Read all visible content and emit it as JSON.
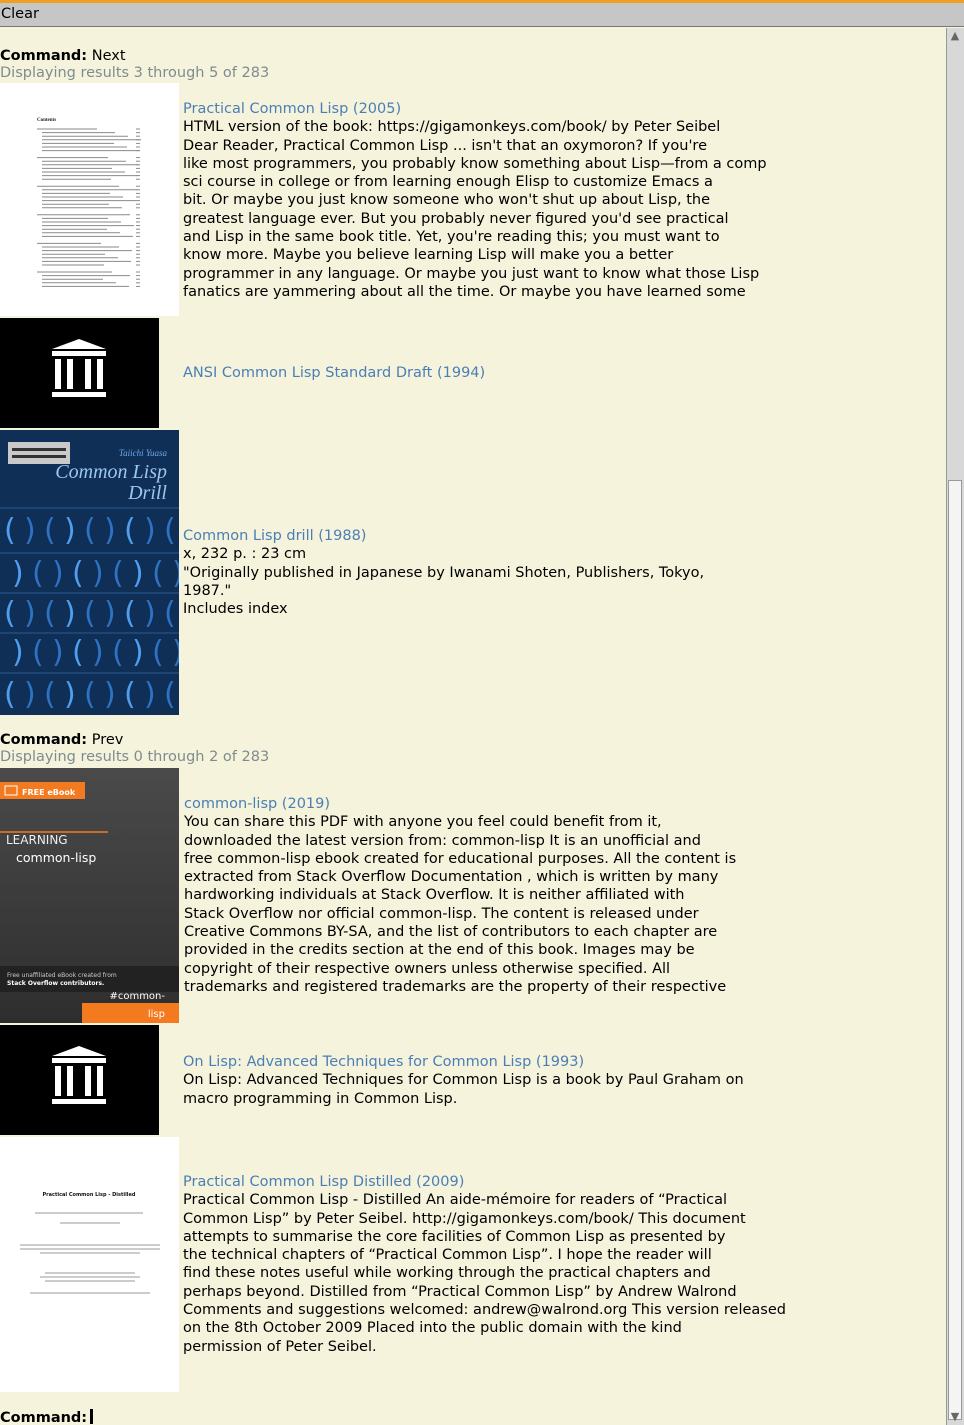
{
  "topbar": {
    "clear_label": "Clear"
  },
  "sections": [
    {
      "command_label": "Command:",
      "command_value": "Next",
      "status": "Displaying results 3 through 5 of 283"
    },
    {
      "command_label": "Command:",
      "command_value": "Prev",
      "status": "Displaying results 0 through 2 of 283"
    }
  ],
  "results": [
    {
      "title": "Practical Common Lisp (2005)",
      "desc": "HTML version of the book: https://gigamonkeys.com/book/ by Peter Seibel\nDear Reader, Practical Common Lisp ... isn't that an oxymoron? If you're\nlike most programmers, you probably know something about Lisp—from a comp\nsci course in college or from learning enough Elisp to customize Emacs a\nbit. Or maybe you just know someone who won't shut up about Lisp, the\ngreatest language ever. But you probably never figured you'd see practical\nand Lisp in the same book title. Yet, you're reading this; you must want to\nknow more. Maybe you believe learning Lisp will make you a better\nprogrammer in any language. Or maybe you just want to know what those Lisp\nfanatics are yammering about all the time. Or maybe you have learned some",
      "thumb_heading": "Contents"
    },
    {
      "title": "ANSI Common Lisp Standard Draft (1994)",
      "desc": ""
    },
    {
      "title": "Common Lisp drill (1988)",
      "desc": "x, 232 p. : 23 cm\n\"Originally published in Japanese by Iwanami Shoten, Publishers, Tokyo,\n1987.\"\nIncludes index",
      "thumb_author": "Taiichi Yuasa",
      "thumb_title1": "Common Lisp",
      "thumb_title2": "Drill"
    },
    {
      "title": "common-lisp (2019)",
      "desc": "You can share this PDF with anyone you feel could benefit from it,\ndownloaded the latest version from: common-lisp It is an unofficial and\nfree common-lisp ebook created for educational purposes. All the content is\nextracted from Stack Overflow Documentation , which is written by many\nhardworking individuals at Stack Overflow. It is neither affiliated with\nStack Overflow nor official common-lisp. The content is released under\nCreative Commons BY-SA, and the list of contributors to each chapter are\nprovided in the credits section at the end of this book. Images may be\ncopyright of their respective owners unless otherwise specified. All\ntrademarks and registered trademarks are the property of their respective",
      "thumb_badge": "FREE eBook",
      "thumb_learning": "LEARNING",
      "thumb_name": "common-lisp",
      "thumb_footer1": "Free unaffiliated eBook created from",
      "thumb_footer2": "Stack Overflow contributors.",
      "thumb_tag1": "#common-",
      "thumb_tag2": "lisp"
    },
    {
      "title": "On Lisp: Advanced Techniques for Common Lisp (1993)",
      "desc": "On Lisp: Advanced Techniques for Common Lisp is a book by Paul Graham on\nmacro programming in Common Lisp."
    },
    {
      "title": "Practical Common Lisp Distilled (2009)",
      "desc": "Practical Common Lisp - Distilled An aide-mémoire for readers of “Practical\nCommon Lisp” by Peter Seibel. http://gigamonkeys.com/book/ This document\nattempts to summarise the core facilities of Common Lisp as presented by\nthe technical chapters of “Practical Common Lisp”. I hope the reader will\nfind these notes useful while working through the practical chapters and\nperhaps beyond. Distilled from “Practical Common Lisp” by Andrew Walrond\nComments and suggestions welcomed: andrew@walrond.org This version released\non the 8th October 2009 Placed into the public domain with the kind\npermission of Peter Seibel.",
      "thumb_heading": "Practical Common Lisp - Distilled"
    }
  ],
  "prompt": {
    "command_label": "Command:"
  },
  "colors": {
    "background": "#f5f3dc",
    "link": "#4a7fb5",
    "status": "#7f8c8d",
    "accent": "#f0a020"
  },
  "icons": {
    "archive": "archive-building-icon"
  }
}
